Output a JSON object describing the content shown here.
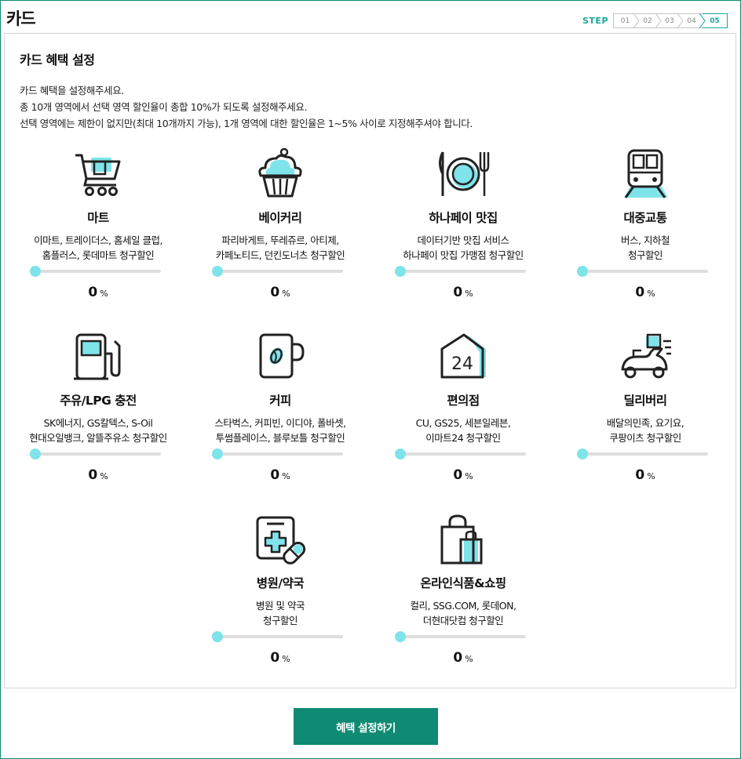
{
  "page_title": "카드",
  "steps": {
    "label": "STEP",
    "items": [
      "01",
      "02",
      "03",
      "04",
      "05"
    ],
    "active_index": 4
  },
  "section": {
    "title": "카드 혜택 설정",
    "description": [
      "카드 혜택을 설정해주세요.",
      "총 10개 영역에서 선택 영역 할인율이 총합 10%가 되도록 설정해주세요.",
      "선택 영역에는 제한이 없지만(최대 10개까지 가능), 1개 영역에 대한 할인율은 1~5% 사이로 지정해주셔야 합니다."
    ]
  },
  "categories": [
    {
      "name": "마트",
      "lines": [
        "이마트, 트레이더스, 홈세일 클럽,",
        "홈플러스, 롯데마트 청구할인"
      ],
      "value": "0",
      "unit": "%",
      "icon": "cart-icon"
    },
    {
      "name": "베이커리",
      "lines": [
        "파리바게트, 뚜레쥬르, 아티제,",
        "카페노티드, 던킨도너츠 청구할인"
      ],
      "value": "0",
      "unit": "%",
      "icon": "cupcake-icon"
    },
    {
      "name": "하나페이 맛집",
      "lines": [
        "데이터기반 맛집 서비스",
        "하나페이 맛집 가맹점 청구할인"
      ],
      "value": "0",
      "unit": "%",
      "icon": "dining-icon"
    },
    {
      "name": "대중교통",
      "lines": [
        "버스, 지하철",
        "청구할인"
      ],
      "value": "0",
      "unit": "%",
      "icon": "train-icon"
    },
    {
      "name": "주유/LPG 충전",
      "lines": [
        "SK에너지, GS칼텍스, S-Oil",
        "현대오일뱅크, 알뜰주유소 청구할인"
      ],
      "value": "0",
      "unit": "%",
      "icon": "fuel-pump-icon"
    },
    {
      "name": "커피",
      "lines": [
        "스타벅스, 커피빈, 이디야, 폴바셋,",
        "투썸플레이스, 블루보틀 청구할인"
      ],
      "value": "0",
      "unit": "%",
      "icon": "coffee-mug-icon"
    },
    {
      "name": "편의점",
      "lines": [
        "CU, GS25, 세븐일레븐,",
        "이마트24 청구할인"
      ],
      "value": "0",
      "unit": "%",
      "icon": "store-24-icon"
    },
    {
      "name": "딜리버리",
      "lines": [
        "배달의민족, 요기요,",
        "쿠팡이츠 청구할인"
      ],
      "value": "0",
      "unit": "%",
      "icon": "delivery-scooter-icon"
    },
    {
      "name": "병원/약국",
      "lines": [
        "병원 및 약국",
        "청구할인"
      ],
      "value": "0",
      "unit": "%",
      "icon": "medical-icon"
    },
    {
      "name": "온라인식품&쇼핑",
      "lines": [
        "컬리, SSG.COM, 롯데ON,",
        "더현대닷컴 청구할인"
      ],
      "value": "0",
      "unit": "%",
      "icon": "shopping-bag-icon"
    }
  ],
  "submit_label": "혜택 설정하기",
  "colors": {
    "accent": "#0f8a73",
    "icon_fill": "#7fe3ea",
    "step_active": "#1aa79d"
  }
}
